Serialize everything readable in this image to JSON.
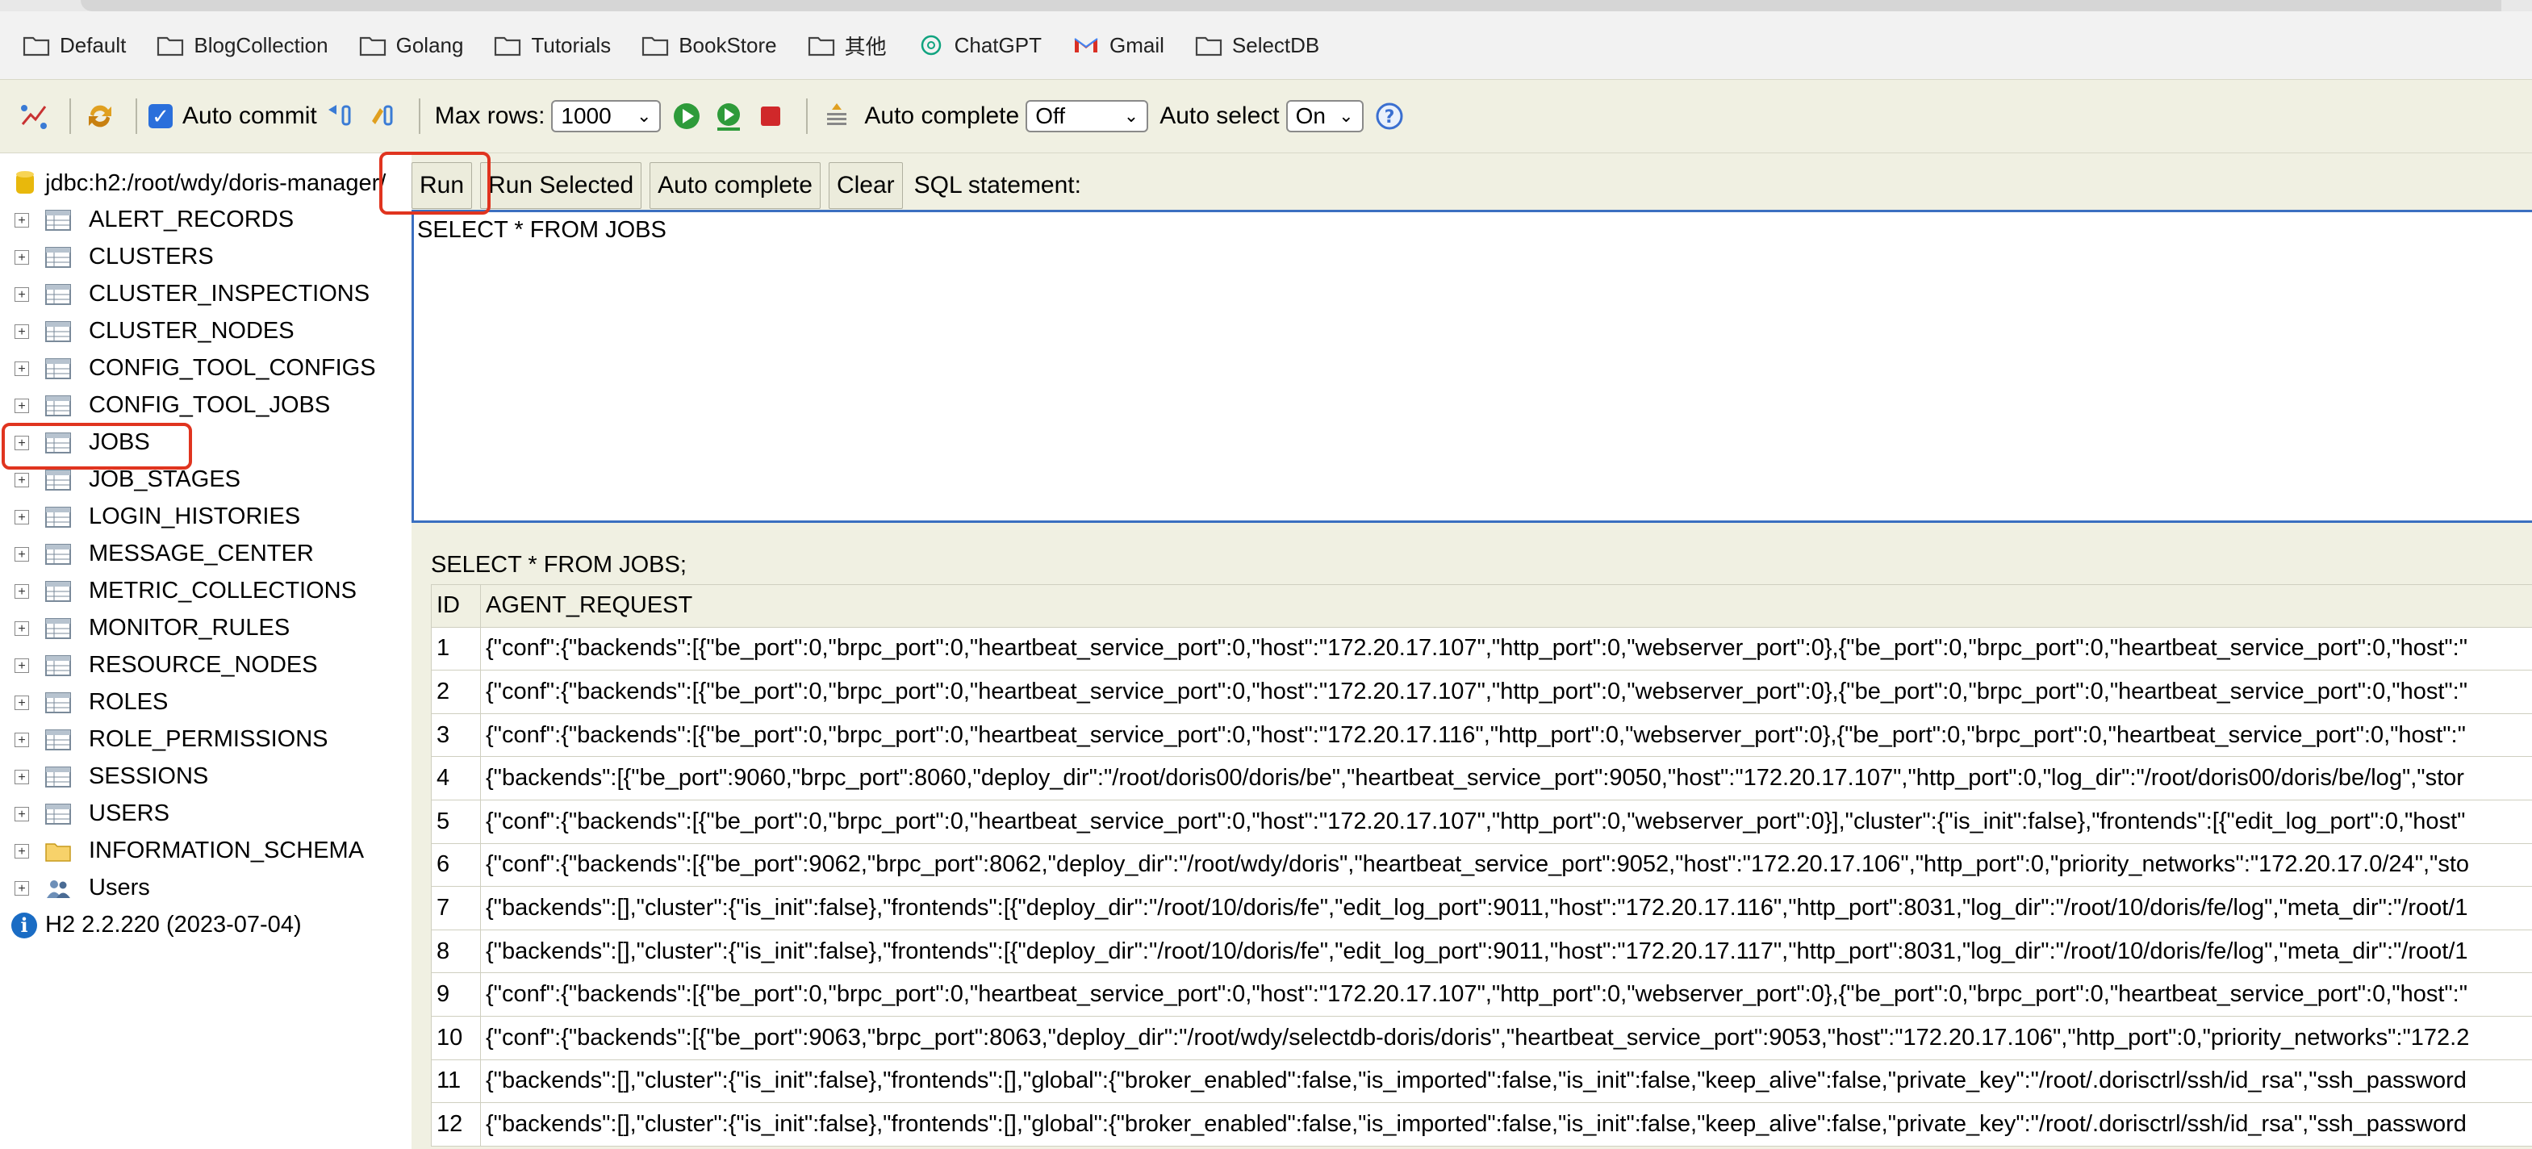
{
  "bookmarks": [
    {
      "label": "Default",
      "icon": "folder-icon"
    },
    {
      "label": "BlogCollection",
      "icon": "folder-icon"
    },
    {
      "label": "Golang",
      "icon": "folder-icon"
    },
    {
      "label": "Tutorials",
      "icon": "folder-icon"
    },
    {
      "label": "BookStore",
      "icon": "folder-icon"
    },
    {
      "label": "其他",
      "icon": "folder-icon"
    },
    {
      "label": "ChatGPT",
      "icon": "chatgpt-icon"
    },
    {
      "label": "Gmail",
      "icon": "gmail-icon"
    },
    {
      "label": "SelectDB",
      "icon": "folder-icon"
    }
  ],
  "toolbar": {
    "auto_commit_label": "Auto commit",
    "auto_commit_checked": true,
    "max_rows_label": "Max rows:",
    "max_rows_value": "1000",
    "auto_complete_label": "Auto complete",
    "auto_complete_value": "Off",
    "auto_select_label": "Auto select",
    "auto_select_value": "On"
  },
  "tree": {
    "connection": "jdbc:h2:/root/wdy/doris-manager/",
    "tables": [
      "ALERT_RECORDS",
      "CLUSTERS",
      "CLUSTER_INSPECTIONS",
      "CLUSTER_NODES",
      "CONFIG_TOOL_CONFIGS",
      "CONFIG_TOOL_JOBS",
      "JOBS",
      "JOB_STAGES",
      "LOGIN_HISTORIES",
      "MESSAGE_CENTER",
      "METRIC_COLLECTIONS",
      "MONITOR_RULES",
      "RESOURCE_NODES",
      "ROLES",
      "ROLE_PERMISSIONS",
      "SESSIONS",
      "USERS"
    ],
    "schema": "INFORMATION_SCHEMA",
    "users": "Users",
    "version": "H2 2.2.220 (2023-07-04)"
  },
  "query": {
    "buttons": {
      "run": "Run",
      "run_selected": "Run Selected",
      "auto_complete": "Auto complete",
      "clear": "Clear"
    },
    "sql_label": "SQL statement:",
    "sql_text": "SELECT * FROM JOBS"
  },
  "result": {
    "title": "SELECT * FROM JOBS;",
    "columns": [
      "ID",
      "AGENT_REQUEST"
    ],
    "rows": [
      {
        "id": "1",
        "agent_request": "{\"conf\":{\"backends\":[{\"be_port\":0,\"brpc_port\":0,\"heartbeat_service_port\":0,\"host\":\"172.20.17.107\",\"http_port\":0,\"webserver_port\":0},{\"be_port\":0,\"brpc_port\":0,\"heartbeat_service_port\":0,\"host\":\""
      },
      {
        "id": "2",
        "agent_request": "{\"conf\":{\"backends\":[{\"be_port\":0,\"brpc_port\":0,\"heartbeat_service_port\":0,\"host\":\"172.20.17.107\",\"http_port\":0,\"webserver_port\":0},{\"be_port\":0,\"brpc_port\":0,\"heartbeat_service_port\":0,\"host\":\""
      },
      {
        "id": "3",
        "agent_request": "{\"conf\":{\"backends\":[{\"be_port\":0,\"brpc_port\":0,\"heartbeat_service_port\":0,\"host\":\"172.20.17.116\",\"http_port\":0,\"webserver_port\":0},{\"be_port\":0,\"brpc_port\":0,\"heartbeat_service_port\":0,\"host\":\""
      },
      {
        "id": "4",
        "agent_request": "{\"backends\":[{\"be_port\":9060,\"brpc_port\":8060,\"deploy_dir\":\"/root/doris00/doris/be\",\"heartbeat_service_port\":9050,\"host\":\"172.20.17.107\",\"http_port\":0,\"log_dir\":\"/root/doris00/doris/be/log\",\"stor"
      },
      {
        "id": "5",
        "agent_request": "{\"conf\":{\"backends\":[{\"be_port\":0,\"brpc_port\":0,\"heartbeat_service_port\":0,\"host\":\"172.20.17.107\",\"http_port\":0,\"webserver_port\":0}],\"cluster\":{\"is_init\":false},\"frontends\":[{\"edit_log_port\":0,\"host\""
      },
      {
        "id": "6",
        "agent_request": "{\"conf\":{\"backends\":[{\"be_port\":9062,\"brpc_port\":8062,\"deploy_dir\":\"/root/wdy/doris\",\"heartbeat_service_port\":9052,\"host\":\"172.20.17.106\",\"http_port\":0,\"priority_networks\":\"172.20.17.0/24\",\"sto"
      },
      {
        "id": "7",
        "agent_request": "{\"backends\":[],\"cluster\":{\"is_init\":false},\"frontends\":[{\"deploy_dir\":\"/root/10/doris/fe\",\"edit_log_port\":9011,\"host\":\"172.20.17.116\",\"http_port\":8031,\"log_dir\":\"/root/10/doris/fe/log\",\"meta_dir\":\"/root/1"
      },
      {
        "id": "8",
        "agent_request": "{\"backends\":[],\"cluster\":{\"is_init\":false},\"frontends\":[{\"deploy_dir\":\"/root/10/doris/fe\",\"edit_log_port\":9011,\"host\":\"172.20.17.117\",\"http_port\":8031,\"log_dir\":\"/root/10/doris/fe/log\",\"meta_dir\":\"/root/1"
      },
      {
        "id": "9",
        "agent_request": "{\"conf\":{\"backends\":[{\"be_port\":0,\"brpc_port\":0,\"heartbeat_service_port\":0,\"host\":\"172.20.17.107\",\"http_port\":0,\"webserver_port\":0},{\"be_port\":0,\"brpc_port\":0,\"heartbeat_service_port\":0,\"host\":\""
      },
      {
        "id": "10",
        "agent_request": "{\"conf\":{\"backends\":[{\"be_port\":9063,\"brpc_port\":8063,\"deploy_dir\":\"/root/wdy/selectdb-doris/doris\",\"heartbeat_service_port\":9053,\"host\":\"172.20.17.106\",\"http_port\":0,\"priority_networks\":\"172.2"
      },
      {
        "id": "11",
        "agent_request": "{\"backends\":[],\"cluster\":{\"is_init\":false},\"frontends\":[],\"global\":{\"broker_enabled\":false,\"is_imported\":false,\"is_init\":false,\"keep_alive\":false,\"private_key\":\"/root/.dorisctrl/ssh/id_rsa\",\"ssh_password"
      },
      {
        "id": "12",
        "agent_request": "{\"backends\":[],\"cluster\":{\"is_init\":false},\"frontends\":[],\"global\":{\"broker_enabled\":false,\"is_imported\":false,\"is_init\":false,\"keep_alive\":false,\"private_key\":\"/root/.dorisctrl/ssh/id_rsa\",\"ssh_password"
      }
    ]
  },
  "colors": {
    "accent": "#3b6fc0",
    "highlight": "#e0341f",
    "panel": "#f0f0e2"
  }
}
